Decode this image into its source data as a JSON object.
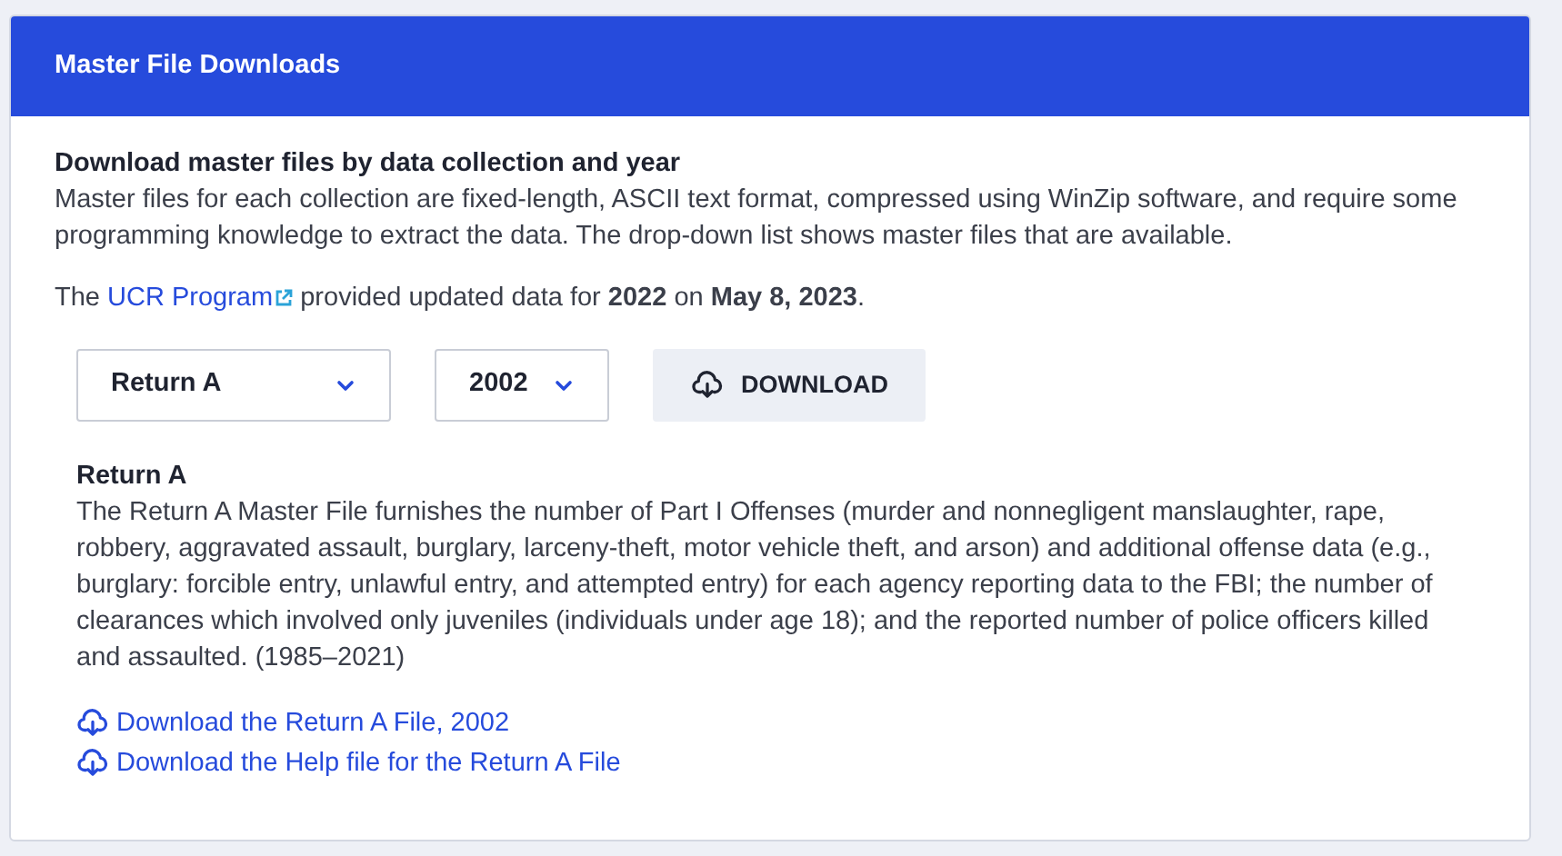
{
  "card": {
    "title": "Master File Downloads"
  },
  "intro": {
    "heading": "Download master files by data collection and year",
    "text": "Master files for each collection are fixed-length, ASCII text format, compressed using WinZip software, and require some programming knowledge to extract the data. The drop-down list shows master files that are available."
  },
  "update_note": {
    "prefix": "The",
    "link": "UCR Program",
    "suffix": "provided updated data for **2022** on **May 8, 2023**."
  },
  "controls": {
    "collection_select": "Return A",
    "year_select": "2002",
    "download_button": "DOWNLOAD"
  },
  "description": {
    "heading": "Return A",
    "text": "The Return A Master File furnishes the number of Part I Offenses (murder and nonnegligent manslaughter, rape, robbery, aggravated assault, burglary, larceny-theft, motor vehicle theft, and arson) and additional offense data (e.g., burglary: forcible entry, unlawful entry, and attempted entry) for each agency reporting data to the FBI; the number of clearances which involved only juveniles (individuals under age 18); and the reported number of police officers killed and assaulted. (1985–2021)"
  },
  "links": [
    "Download the Return A File, 2002",
    "Download the Help file for the Return A File"
  ]
}
